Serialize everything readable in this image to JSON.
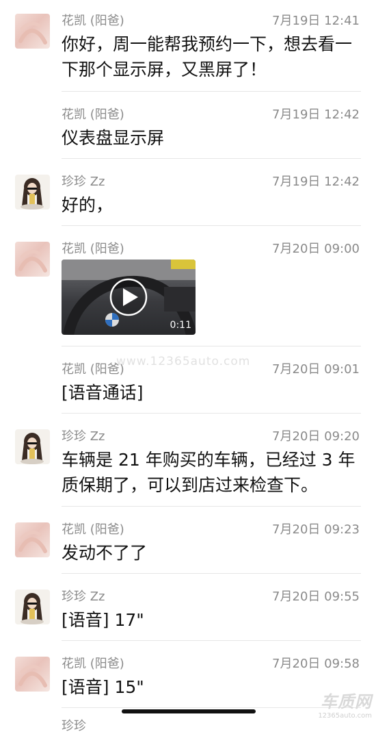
{
  "messages": [
    {
      "sender": "花凯 (阳爸)",
      "time": "7月19日 12:41",
      "text": "你好，周一能帮我预约一下，想去看一下那个显示屏，又黑屏了！",
      "avatar": "hand"
    },
    {
      "sender": "花凯 (阳爸)",
      "time": "7月19日 12:42",
      "text": "仪表盘显示屏",
      "avatar": "none"
    },
    {
      "sender": "珍珍 Zz",
      "time": "7月19日 12:42",
      "text": "好的，",
      "avatar": "girl"
    },
    {
      "sender": "花凯 (阳爸)",
      "time": "7月20日 09:00",
      "video_duration": "0:11",
      "avatar": "hand"
    },
    {
      "sender": "花凯 (阳爸)",
      "time": "7月20日 09:01",
      "text": "[语音通话]",
      "avatar": "none"
    },
    {
      "sender": "珍珍 Zz",
      "time": "7月20日 09:20",
      "text": "车辆是 21 年购买的车辆，已经过 3 年质保期了，可以到店过来检查下。",
      "avatar": "girl"
    },
    {
      "sender": "花凯 (阳爸)",
      "time": "7月20日 09:23",
      "text": "发动不了了",
      "avatar": "hand"
    },
    {
      "sender": "珍珍 Zz",
      "time": "7月20日 09:55",
      "text": "[语音] 17\"",
      "avatar": "girl"
    },
    {
      "sender": "花凯 (阳爸)",
      "time": "7月20日 09:58",
      "text": "[语音] 15\"",
      "avatar": "hand"
    }
  ],
  "partial_sender": "珍珍",
  "watermark": "www.12365auto.com",
  "logo": {
    "name": "车质网",
    "url": "12365auto.com"
  },
  "colors": {
    "meta": "#8a8a8a",
    "text": "#111111",
    "divider": "#e6e6e6"
  },
  "icons": {
    "video_play": "play-icon"
  }
}
